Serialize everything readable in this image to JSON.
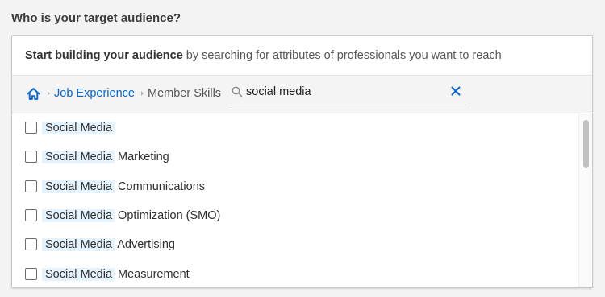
{
  "question": "Who is your target audience?",
  "intro": {
    "bold": "Start building your audience",
    "rest": " by searching for attributes of professionals you want to reach"
  },
  "breadcrumb": {
    "home_icon": "home-icon",
    "link": "Job Experience",
    "current": "Member Skills"
  },
  "search": {
    "value": "social media",
    "placeholder": "",
    "clear_icon": "close-icon"
  },
  "colors": {
    "link": "#0a66c2",
    "highlight": "#e4f3fd"
  },
  "results": [
    {
      "match": "Social Media",
      "rest": ""
    },
    {
      "match": "Social Media",
      "rest": " Marketing"
    },
    {
      "match": "Social Media",
      "rest": " Communications"
    },
    {
      "match": "Social Media",
      "rest": " Optimization (SMO)"
    },
    {
      "match": "Social Media",
      "rest": " Advertising"
    },
    {
      "match": "Social Media",
      "rest": " Measurement"
    }
  ]
}
